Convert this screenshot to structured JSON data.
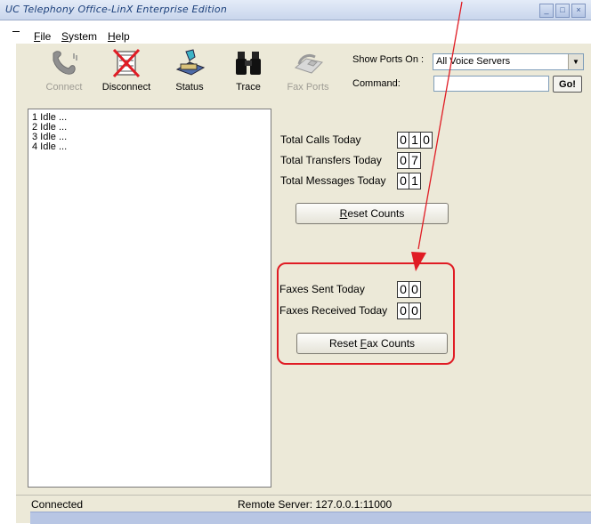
{
  "window": {
    "title": "UC Telephony Office-LinX Enterprise Edition",
    "min_glyph": "_",
    "max_glyph": "□",
    "close_glyph": "×"
  },
  "menu": {
    "items": [
      "File",
      "System",
      "Help"
    ]
  },
  "toolbar": {
    "buttons": [
      {
        "label": "Connect",
        "icon": "phone-handset-icon",
        "enabled": false
      },
      {
        "label": "Disconnect",
        "icon": "disconnect-icon",
        "enabled": true
      },
      {
        "label": "Status",
        "icon": "status-icon",
        "enabled": true
      },
      {
        "label": "Trace",
        "icon": "binoculars-icon",
        "enabled": true
      },
      {
        "label": "Fax Ports",
        "icon": "fax-icon",
        "enabled": false
      }
    ],
    "show_ports_label": "Show Ports On :",
    "show_ports_value": "All Voice Servers",
    "command_label": "Command:",
    "command_value": "",
    "go_label": "Go!"
  },
  "ports": [
    "1 Idle ...",
    "2 Idle ...",
    "3 Idle ...",
    "4 Idle ..."
  ],
  "stats": {
    "total_calls_label": "Total Calls Today",
    "total_calls_digits": [
      "0",
      "1",
      "0"
    ],
    "total_transfers_label": "Total Transfers Today",
    "total_transfers_digits": [
      "0",
      "7"
    ],
    "total_messages_label": "Total Messages Today",
    "total_messages_digits": [
      "0",
      "1"
    ],
    "reset_counts_label": "Reset Counts"
  },
  "fax": {
    "sent_label": "Faxes Sent Today",
    "sent_digits": [
      "0",
      "0"
    ],
    "received_label": "Faxes Received Today",
    "received_digits": [
      "0",
      "0"
    ],
    "reset_label": "Reset Fax Counts"
  },
  "status_bar": {
    "left": "Connected",
    "right": "Remote Server: 127.0.0.1:11000"
  },
  "colors": {
    "annotation": "#e01c24",
    "panel": "#ece9d8"
  }
}
